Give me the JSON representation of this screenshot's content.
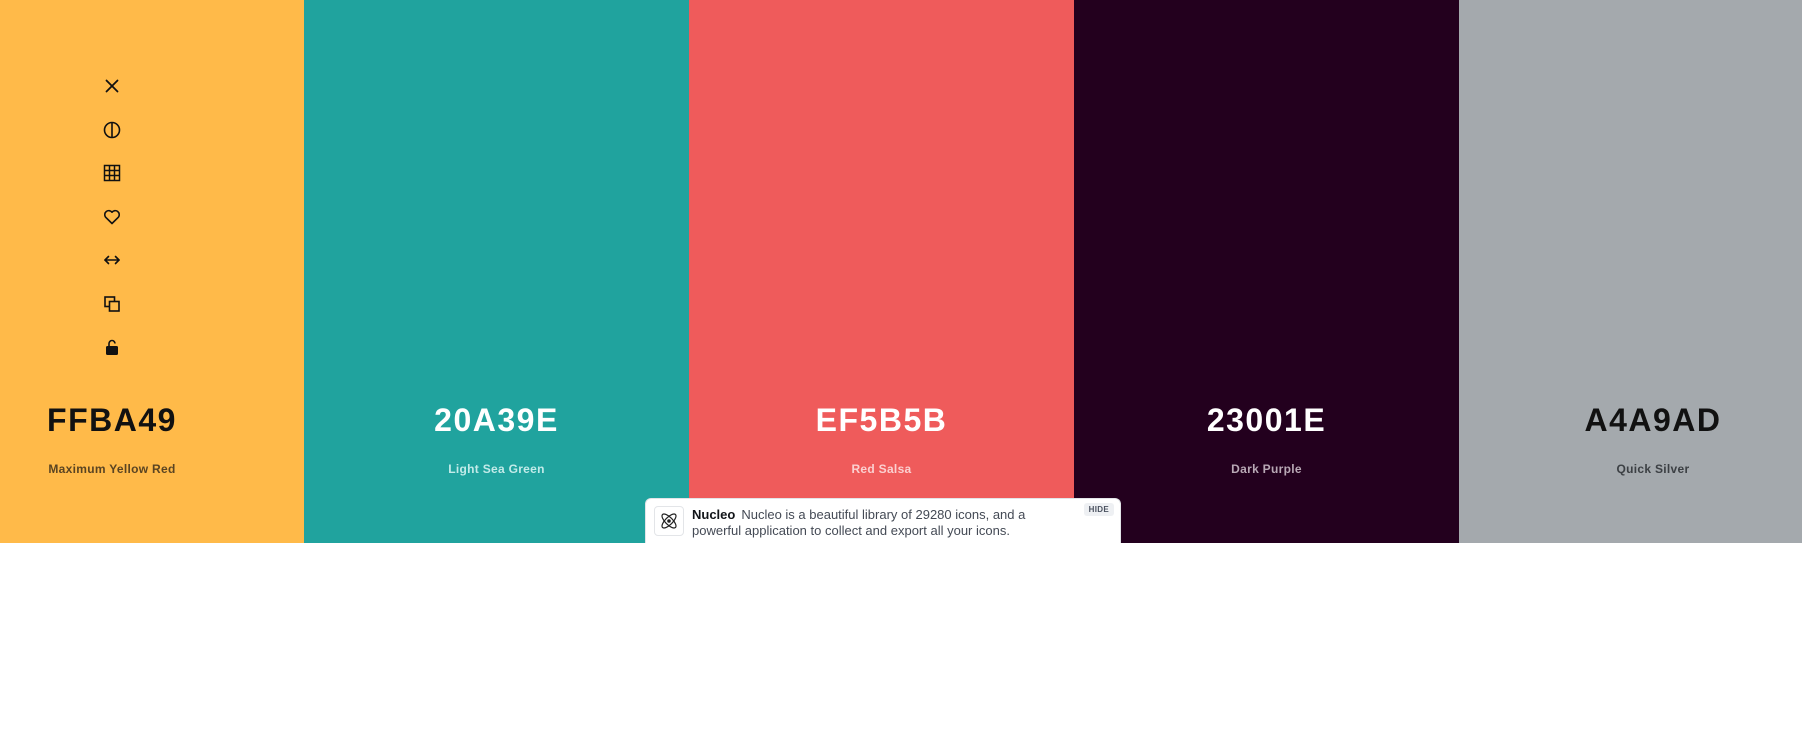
{
  "palette": {
    "colors": [
      {
        "hex": "FFBA49",
        "name": "Maximum Yellow Red",
        "bg": "#FFBA49",
        "hex_color": "#111111",
        "name_color": "#5a4422"
      },
      {
        "hex": "20A39E",
        "name": "Light Sea Green",
        "bg": "#20A39E",
        "hex_color": "#ffffff",
        "name_color": "#c3ebe9"
      },
      {
        "hex": "EF5B5B",
        "name": "Red Salsa",
        "bg": "#EF5B5B",
        "hex_color": "#ffffff",
        "name_color": "#fbd0d0"
      },
      {
        "hex": "23001E",
        "name": "Dark Purple",
        "bg": "#23001E",
        "hex_color": "#ffffff",
        "name_color": "#b8a8b5"
      },
      {
        "hex": "A4A9AD",
        "name": "Quick Silver",
        "bg": "#A4A9AD",
        "hex_color": "#111111",
        "name_color": "#3c4044"
      }
    ]
  },
  "toolbar": {
    "icons": [
      "close-icon",
      "contrast-icon",
      "grid-icon",
      "heart-icon",
      "arrows-horizontal-icon",
      "copy-icon",
      "unlock-icon"
    ]
  },
  "toast": {
    "title": "Nucleo",
    "message": "Nucleo is a beautiful library of 29280 icons, and a powerful application to collect and export all your icons.",
    "hide_label": "HIDE",
    "logo_icon": "nucleo-logo-icon"
  }
}
